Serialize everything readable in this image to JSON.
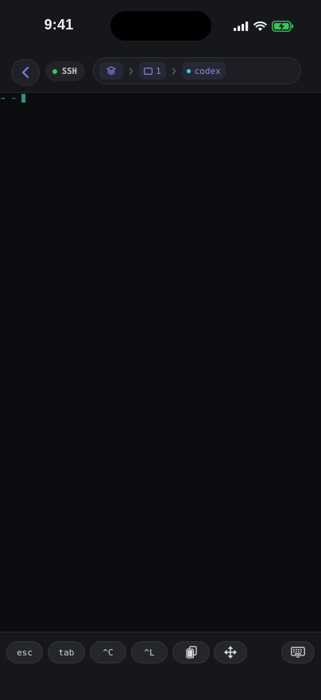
{
  "status_bar": {
    "time": "9:41",
    "icons": [
      "cellular-signal-icon",
      "wifi-icon",
      "battery-charging-icon"
    ],
    "battery_color": "#34c759"
  },
  "nav": {
    "back_icon": "chevron-left-icon",
    "connection": {
      "label": "SSH",
      "status_color": "#37c95a"
    },
    "breadcrumb": {
      "session_icon": "layers-icon",
      "window": {
        "icon": "window-icon",
        "label": "1"
      },
      "pane": {
        "label": "codex",
        "status_color": "#3fd4e0"
      }
    },
    "accent_color": "#8a88e6"
  },
  "terminal": {
    "prompt_symbol": "→",
    "cwd": "~"
  },
  "key_bar": {
    "keys": [
      {
        "label": "esc"
      },
      {
        "label": "tab"
      },
      {
        "label": "^C"
      },
      {
        "label": "^L"
      }
    ],
    "paste_icon": "clipboard-icon",
    "move_icon": "move-arrows-icon",
    "keyboard_icon": "keyboard-icon"
  }
}
